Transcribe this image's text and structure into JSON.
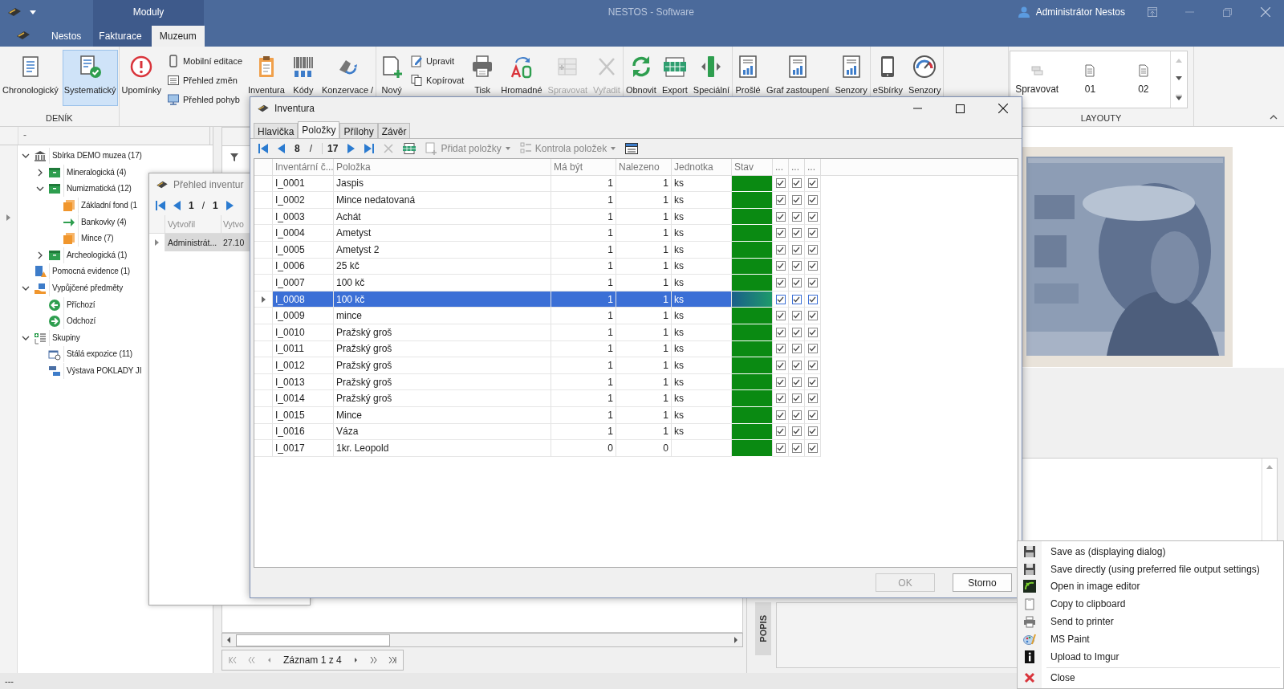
{
  "title_bar": {
    "app_menu": "Moduly",
    "title": "NESTOS - Software",
    "user": "Administrátor Nestos"
  },
  "tabs": [
    {
      "label": "Nestos",
      "selected": false
    },
    {
      "label": "Fakturace",
      "selected": false
    },
    {
      "label": "Muzeum",
      "selected": true
    }
  ],
  "ribbon": {
    "groups": [
      {
        "label": "DENÍK",
        "items": [
          {
            "kind": "large",
            "label": "Chronologický",
            "selected": false,
            "disabled": false
          },
          {
            "kind": "large",
            "label": "Systematický",
            "selected": true,
            "disabled": false
          }
        ]
      },
      {
        "items": [
          {
            "kind": "large",
            "label": "Upomínky",
            "selected": false,
            "disabled": false
          },
          {
            "kind": "stack",
            "items": [
              {
                "label": "Mobilní editace"
              },
              {
                "label": "Přehled změn"
              },
              {
                "label": "Přehled pohyb"
              }
            ]
          },
          {
            "kind": "large",
            "label": "Inventura",
            "selected": false,
            "disabled": false
          },
          {
            "kind": "large",
            "label": "Kódy",
            "selected": false,
            "disabled": false
          },
          {
            "kind": "large",
            "label": "Konzervace /",
            "selected": false,
            "disabled": false
          }
        ]
      },
      {
        "items": [
          {
            "kind": "large",
            "label": "Nový",
            "selected": false,
            "disabled": false
          },
          {
            "kind": "stack",
            "items": [
              {
                "label": "Upravit"
              },
              {
                "label": "Kopírovat"
              }
            ]
          },
          {
            "kind": "large",
            "label": "Tisk",
            "selected": false,
            "disabled": false
          },
          {
            "kind": "large",
            "label": "Hromadné",
            "selected": false,
            "disabled": false
          },
          {
            "kind": "large",
            "label": "Spravovat",
            "selected": false,
            "disabled": true
          },
          {
            "kind": "large",
            "label": "Vyřadit",
            "selected": false,
            "disabled": true
          }
        ]
      },
      {
        "items": [
          {
            "kind": "large",
            "label": "Obnovit",
            "selected": false,
            "disabled": false
          },
          {
            "kind": "large",
            "label": "Export",
            "selected": false,
            "disabled": false
          },
          {
            "kind": "large",
            "label": "Speciální",
            "selected": false,
            "disabled": false
          }
        ]
      },
      {
        "items": [
          {
            "kind": "large",
            "label": "Prošlé",
            "selected": false,
            "disabled": false
          },
          {
            "kind": "large",
            "label": "Graf zastoupení",
            "selected": false,
            "disabled": false
          },
          {
            "kind": "large",
            "label": "Senzory",
            "selected": false,
            "disabled": false
          }
        ]
      },
      {
        "items": [
          {
            "kind": "large",
            "label": "eSbírky",
            "selected": false,
            "disabled": false
          },
          {
            "kind": "large",
            "label": "Senzory",
            "selected": false,
            "disabled": false
          }
        ]
      }
    ],
    "gallery": {
      "label": "LAYOUTY",
      "items": [
        {
          "label": "Spravovat"
        },
        {
          "label": "01"
        },
        {
          "label": "02"
        }
      ]
    }
  },
  "tree": {
    "header": "-",
    "items": [
      {
        "label": "Sbírka DEMO muzea (17)",
        "expanded": true,
        "children": [
          {
            "label": "Mineralogická (4)",
            "expanded": false
          },
          {
            "label": "Numizmatická (12)",
            "expanded": true,
            "children": [
              {
                "label": "Základní fond (1"
              },
              {
                "label": "Bankovky (4)"
              },
              {
                "label": "Mince (7)"
              }
            ]
          },
          {
            "label": "Archeologická (1)",
            "expanded": false
          }
        ]
      },
      {
        "label": "Pomocná evidence (1)"
      },
      {
        "label": "Vypůjčené předměty",
        "expanded": true,
        "children": [
          {
            "label": "Příchozí"
          },
          {
            "label": "Odchozí"
          }
        ]
      },
      {
        "label": "Skupiny",
        "expanded": true,
        "children": [
          {
            "label": "Stálá expozice (11)"
          },
          {
            "label": "Výstava POKLADY JI"
          }
        ]
      }
    ]
  },
  "overview_window": {
    "title": "Přehled inventur",
    "current": "1",
    "separator": "/",
    "total": "1",
    "columns": [
      "Vytvořil",
      "Vytvo"
    ],
    "rows": [
      {
        "cells": [
          "Administrát...",
          "27.10"
        ],
        "selected": true
      }
    ]
  },
  "inventory_dialog": {
    "title": "Inventura",
    "tabs": [
      {
        "label": "Hlavička",
        "selected": false
      },
      {
        "label": "Položky",
        "selected": true
      },
      {
        "label": "Přílohy",
        "selected": false
      },
      {
        "label": "Závěr",
        "selected": false
      }
    ],
    "toolbar": {
      "current": "8",
      "separator": "/",
      "total": "17",
      "add_items": "Přidat položky",
      "check_items": "Kontrola položek"
    },
    "columns": [
      "Inventární č...",
      "Položka",
      "Má být",
      "Nalezeno",
      "Jednotka",
      "Stav",
      "...",
      "...",
      "..."
    ],
    "rows": [
      {
        "code": "I_0001",
        "item": "Jaspis",
        "expected": "1",
        "found": "1",
        "unit": "ks",
        "selected": false,
        "checks": [
          true,
          true,
          true
        ]
      },
      {
        "code": "I_0002",
        "item": "Mince nedatovaná",
        "expected": "1",
        "found": "1",
        "unit": "ks",
        "selected": false,
        "checks": [
          true,
          true,
          true
        ]
      },
      {
        "code": "I_0003",
        "item": "Achát",
        "expected": "1",
        "found": "1",
        "unit": "ks",
        "selected": false,
        "checks": [
          true,
          true,
          true
        ]
      },
      {
        "code": "I_0004",
        "item": "Ametyst",
        "expected": "1",
        "found": "1",
        "unit": "ks",
        "selected": false,
        "checks": [
          true,
          true,
          true
        ]
      },
      {
        "code": "I_0005",
        "item": "Ametyst 2",
        "expected": "1",
        "found": "1",
        "unit": "ks",
        "selected": false,
        "checks": [
          true,
          true,
          true
        ]
      },
      {
        "code": "I_0006",
        "item": "25 kč",
        "expected": "1",
        "found": "1",
        "unit": "ks",
        "selected": false,
        "checks": [
          true,
          true,
          true
        ]
      },
      {
        "code": "I_0007",
        "item": "100 kč",
        "expected": "1",
        "found": "1",
        "unit": "ks",
        "selected": false,
        "checks": [
          true,
          true,
          true
        ]
      },
      {
        "code": "I_0008",
        "item": "100 kč",
        "expected": "1",
        "found": "1",
        "unit": "ks",
        "selected": true,
        "checks": [
          true,
          true,
          true
        ]
      },
      {
        "code": "I_0009",
        "item": "mince",
        "expected": "1",
        "found": "1",
        "unit": "ks",
        "selected": false,
        "checks": [
          true,
          true,
          true
        ]
      },
      {
        "code": "I_0010",
        "item": "Pražský groš",
        "expected": "1",
        "found": "1",
        "unit": "ks",
        "selected": false,
        "checks": [
          true,
          true,
          true
        ]
      },
      {
        "code": "I_0011",
        "item": "Pražský groš",
        "expected": "1",
        "found": "1",
        "unit": "ks",
        "selected": false,
        "checks": [
          true,
          true,
          true
        ]
      },
      {
        "code": "I_0012",
        "item": "Pražský groš",
        "expected": "1",
        "found": "1",
        "unit": "ks",
        "selected": false,
        "checks": [
          true,
          true,
          true
        ]
      },
      {
        "code": "I_0013",
        "item": "Pražský groš",
        "expected": "1",
        "found": "1",
        "unit": "ks",
        "selected": false,
        "checks": [
          true,
          true,
          true
        ]
      },
      {
        "code": "I_0014",
        "item": "Pražský groš",
        "expected": "1",
        "found": "1",
        "unit": "ks",
        "selected": false,
        "checks": [
          true,
          true,
          true
        ]
      },
      {
        "code": "I_0015",
        "item": "Mince",
        "expected": "1",
        "found": "1",
        "unit": "ks",
        "selected": false,
        "checks": [
          true,
          true,
          true
        ]
      },
      {
        "code": "I_0016",
        "item": "Váza",
        "expected": "1",
        "found": "1",
        "unit": "ks",
        "selected": false,
        "checks": [
          true,
          true,
          true
        ]
      },
      {
        "code": "I_0017",
        "item": "1kr. Leopold",
        "expected": "0",
        "found": "0",
        "selected": false,
        "checks": [
          true,
          true,
          true
        ]
      }
    ],
    "buttons": [
      {
        "label": "OK",
        "disabled": true
      },
      {
        "label": "Storno",
        "disabled": false
      }
    ]
  },
  "record_nav": {
    "label": "Záznam 1 z 4"
  },
  "side_tab": "POPIS",
  "context_menu": {
    "items": [
      {
        "kind": "item",
        "label": "Save as (displaying dialog)"
      },
      {
        "kind": "item",
        "label": "Save directly (using preferred file output settings)"
      },
      {
        "kind": "item",
        "label": "Open in image editor"
      },
      {
        "kind": "item",
        "label": "Copy to clipboard"
      },
      {
        "kind": "item",
        "label": "Send to printer"
      },
      {
        "kind": "item",
        "label": "MS Paint"
      },
      {
        "kind": "item",
        "label": "Upload to Imgur"
      },
      {
        "kind": "separator"
      },
      {
        "kind": "item",
        "label": "Close"
      }
    ]
  },
  "status_bar": "---"
}
